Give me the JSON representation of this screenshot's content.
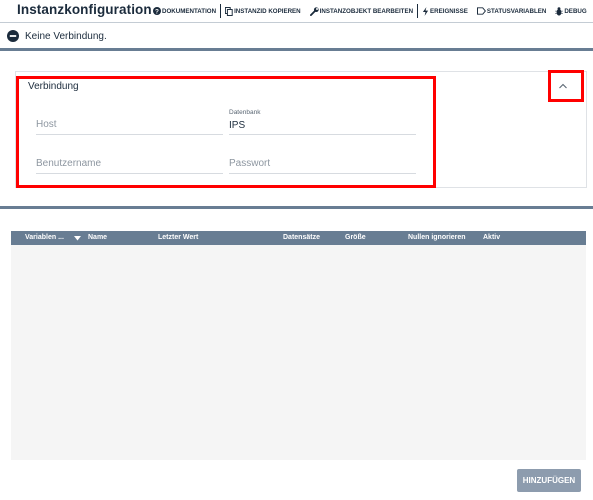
{
  "header": {
    "title": "Instanzkonfiguration",
    "toolbar": [
      {
        "label": "DOKUMENTATION",
        "icon": "help-icon"
      },
      {
        "label": "INSTANZID KOPIEREN",
        "icon": "copy-icon"
      },
      {
        "label": "INSTANZOBJEKT BEARBEITEN",
        "icon": "wrench-icon"
      },
      {
        "label": "EREIGNISSE",
        "icon": "lightning-icon"
      },
      {
        "label": "STATUSVARIABLEN",
        "icon": "tag-icon"
      },
      {
        "label": "DEBUG",
        "icon": "bug-icon"
      }
    ]
  },
  "status": {
    "text": "Keine Verbindung.",
    "icon": "minus-circle-icon"
  },
  "connection": {
    "title": "Verbindung",
    "host_placeholder": "Host",
    "database_label": "Datenbank",
    "database_value": "IPS",
    "username_placeholder": "Benutzername",
    "password_placeholder": "Passwort",
    "collapse_icon": "chevron-up-icon"
  },
  "table": {
    "columns": [
      "Variablen ...",
      "Name",
      "Letzter Wert",
      "Datensätze",
      "Größe",
      "Nullen ignorieren",
      "Aktiv"
    ],
    "rows": []
  },
  "actions": {
    "add_label": "HINZUFÜGEN"
  },
  "colors": {
    "accent": "#687d93",
    "text": "#1b2b3c",
    "highlight": "#ff0000",
    "button": "#8d9cae"
  }
}
